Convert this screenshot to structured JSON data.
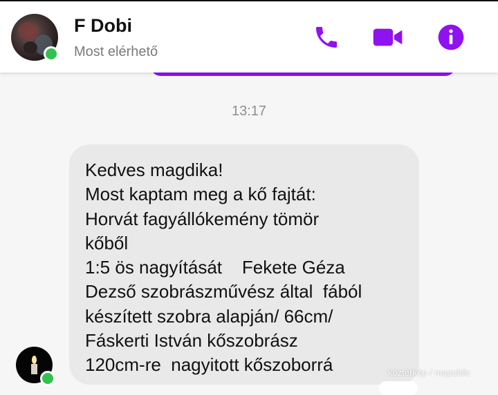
{
  "header": {
    "contact_name": "F Dobi",
    "contact_status": "Most elérhető",
    "icons": [
      "phone-icon",
      "video-camera-icon",
      "info-icon"
    ],
    "accent_color": "#8f12f0",
    "online_color": "#31c24d"
  },
  "conversation": {
    "timestamp": "13:17",
    "message_lines": [
      "Kedves magdika!",
      "Most kaptam meg a kő fajtát:",
      "Horvát fagyállókemény tömör",
      "kőből",
      "1:5 ös nagyítását    Fekete Géza",
      "Dezső szobrászművész által  fából",
      "készített szobra alapján/ 66cm/",
      "Fáskerti István kőszobrász",
      "120cm-re  nagyitott kőszoborrá"
    ],
    "bubble_color": "#e9e9ea"
  },
  "watermark": "köztérkép / mapublic"
}
